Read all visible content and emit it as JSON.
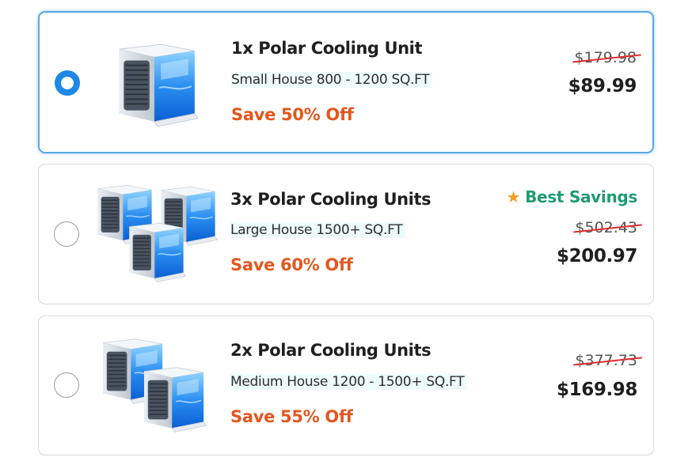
{
  "options": [
    {
      "title": "1x Polar Cooling Unit",
      "subtitle": "Small House 800 - 1200 SQ.FT",
      "savings": "Save 50% Off",
      "old_price": "$179.98",
      "new_price": "$89.99",
      "selected": true
    },
    {
      "title": "3x Polar Cooling Units",
      "subtitle": "Large House 1500+ SQ.FT",
      "savings": "Save 60% Off",
      "old_price": "$502.43",
      "new_price": "$200.97",
      "badge": "Best Savings",
      "badge_icon": "star-icon",
      "selected": false
    },
    {
      "title": "2x Polar Cooling Units",
      "subtitle": "Medium House 1200 - 1500+ SQ.FT",
      "savings": "Save 55% Off",
      "old_price": "$377.73",
      "new_price": "$169.98",
      "selected": false
    }
  ],
  "colors": {
    "selected_border": "#5aa7e6",
    "radio_checked": "#1e88e5",
    "savings_text": "#e2571e",
    "badge_text": "#1e9c72",
    "star": "#f59a23",
    "strike": "#e03030"
  }
}
